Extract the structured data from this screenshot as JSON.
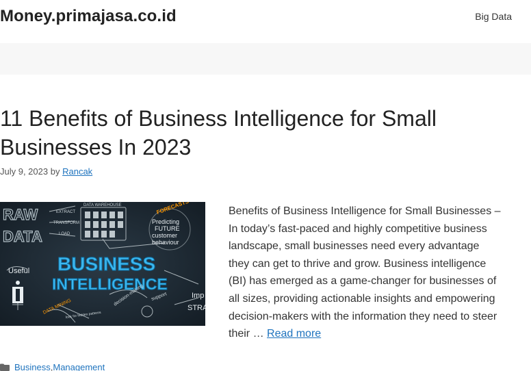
{
  "site": {
    "title": "Money.primajasa.co.id"
  },
  "nav": {
    "items": [
      {
        "label": "Big Data"
      }
    ]
  },
  "post": {
    "title": "11 Benefits of Business Intelligence for Small Businesses In 2023",
    "date": "July 9, 2023",
    "by": "by",
    "author": "Rancak",
    "excerpt": "Benefits of Business Intelligence for Small Businesses – In today’s fast-paced and highly competitive business landscape, small businesses need every advantage they can get to thrive and grow. Business intelligence (BI) has emerged as a game-changer for businesses of all sizes, providing actionable insights and empowering decision-makers with the information they need to steer their …",
    "read_more": "Read more",
    "categories": [
      "Business",
      "Management"
    ],
    "category_separator": ",",
    "image": {
      "labels": {
        "raw": "RAW",
        "data": "DATA",
        "extract": "EXTRACT",
        "transform": "TRANSFORM",
        "load": "LOAD",
        "data_warehouse": "DATA WAREHOUSE",
        "forecasts": "FORECASTS",
        "predicting": "Predicting",
        "future": "FUTURE",
        "customer": "customer",
        "behaviour": "behaviour",
        "business": "BUSINESS",
        "intelligence": "INTELLIGENCE",
        "useful": "Useful",
        "data_mining": "DATA MINING",
        "decision_making": "decision-making",
        "support": "support",
        "imp": "Imp",
        "stra": "STRA",
        "hidden_patterns": "look for hidden patterns"
      }
    }
  }
}
